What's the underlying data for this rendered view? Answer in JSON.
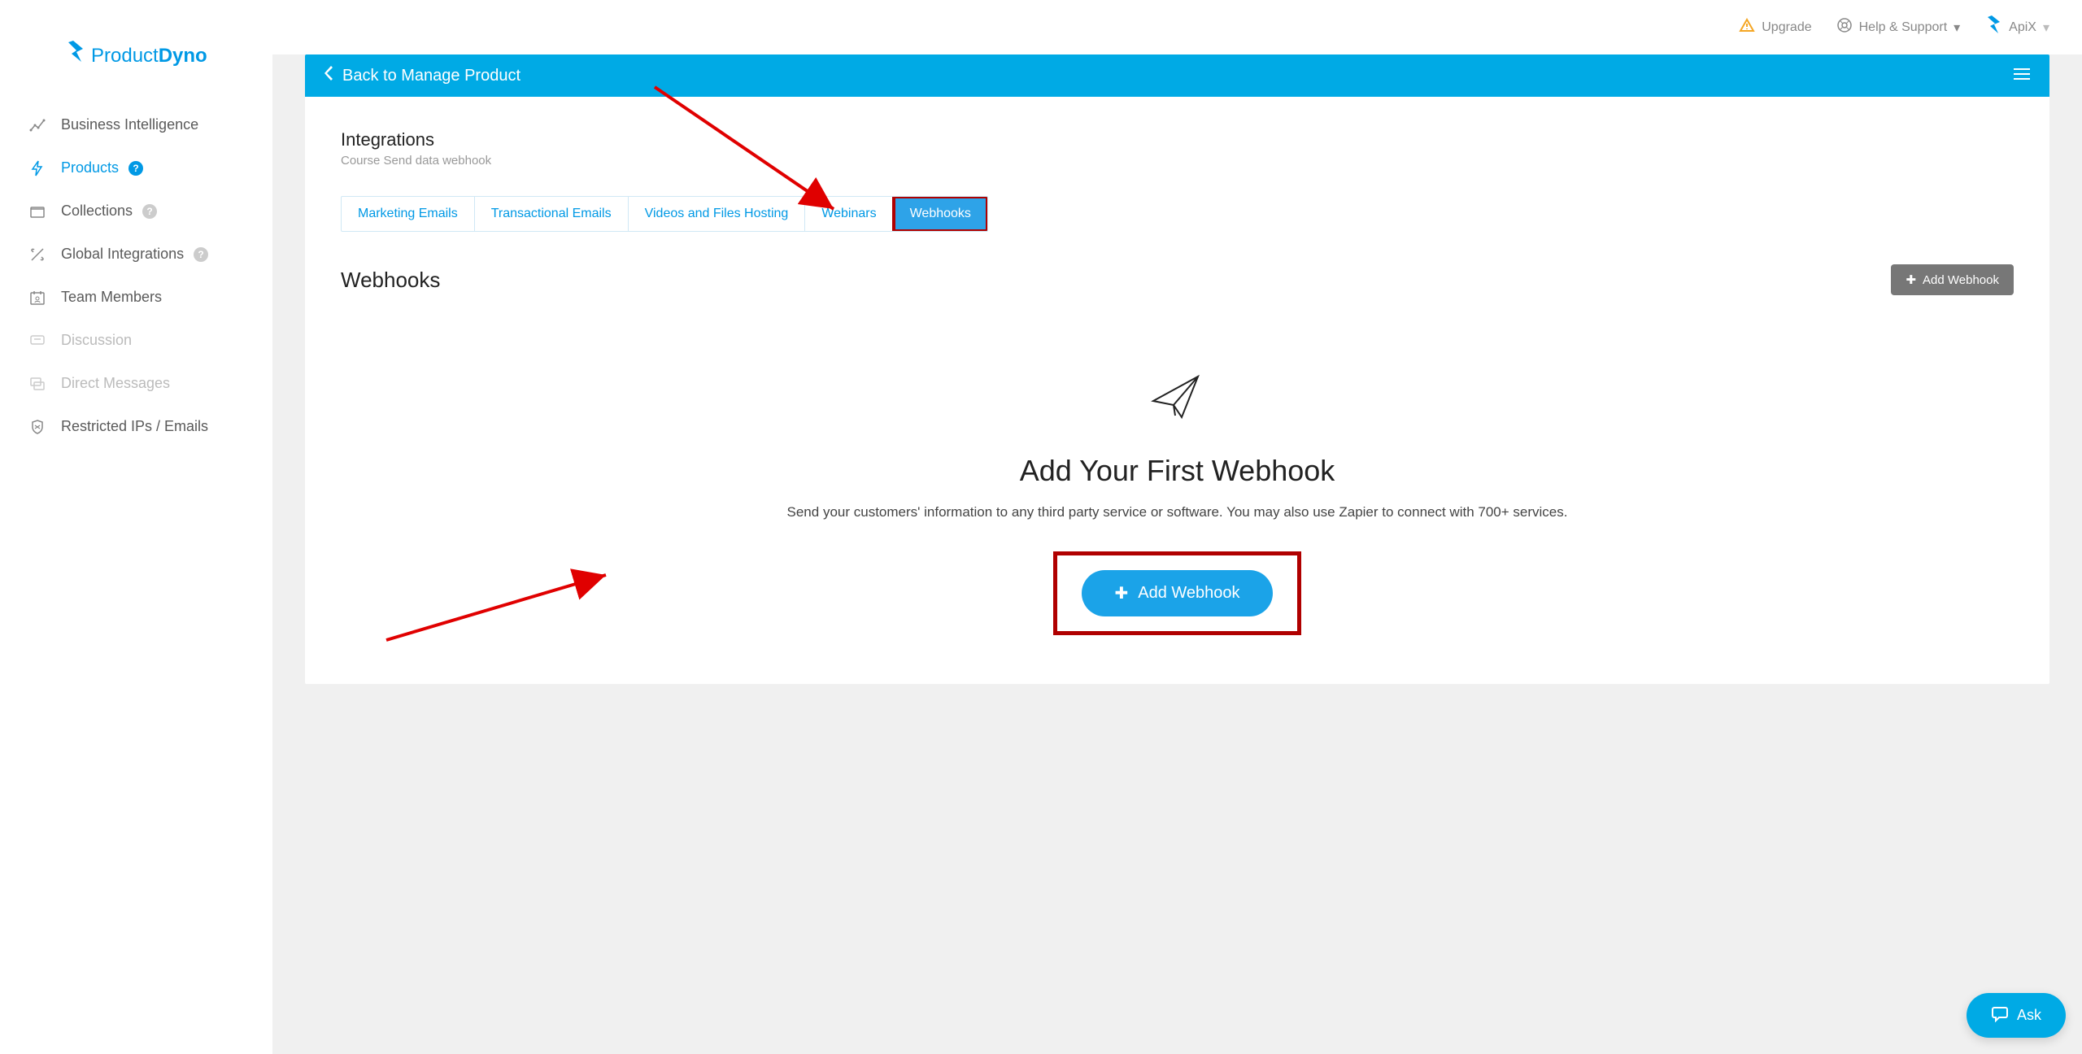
{
  "logo": {
    "product": "Product",
    "dyno": "Dyno"
  },
  "sidebar": {
    "items": [
      {
        "label": "Business Intelligence",
        "active": false,
        "help": false,
        "muted": false
      },
      {
        "label": "Products",
        "active": true,
        "help": true,
        "muted": false
      },
      {
        "label": "Collections",
        "active": false,
        "help": true,
        "muted": false
      },
      {
        "label": "Global Integrations",
        "active": false,
        "help": true,
        "muted": false
      },
      {
        "label": "Team Members",
        "active": false,
        "help": false,
        "muted": false
      },
      {
        "label": "Discussion",
        "active": false,
        "help": false,
        "muted": true
      },
      {
        "label": "Direct Messages",
        "active": false,
        "help": false,
        "muted": true
      },
      {
        "label": "Restricted IPs / Emails",
        "active": false,
        "help": false,
        "muted": false
      }
    ]
  },
  "topbar": {
    "upgrade": "Upgrade",
    "help": "Help & Support",
    "user": "ApiX"
  },
  "header": {
    "back": "Back to Manage Product"
  },
  "panel": {
    "title": "Integrations",
    "subtitle": "Course Send data webhook"
  },
  "tabs": [
    {
      "label": "Marketing Emails",
      "active": false
    },
    {
      "label": "Transactional Emails",
      "active": false
    },
    {
      "label": "Videos and Files Hosting",
      "active": false
    },
    {
      "label": "Webinars",
      "active": false
    },
    {
      "label": "Webhooks",
      "active": true
    }
  ],
  "section": {
    "title": "Webhooks",
    "add_button": "Add Webhook"
  },
  "empty_state": {
    "title": "Add Your First Webhook",
    "desc": "Send your customers' information to any third party service or software. You may also use Zapier to connect with 700+ services.",
    "button": "Add Webhook"
  },
  "ask": "Ask"
}
